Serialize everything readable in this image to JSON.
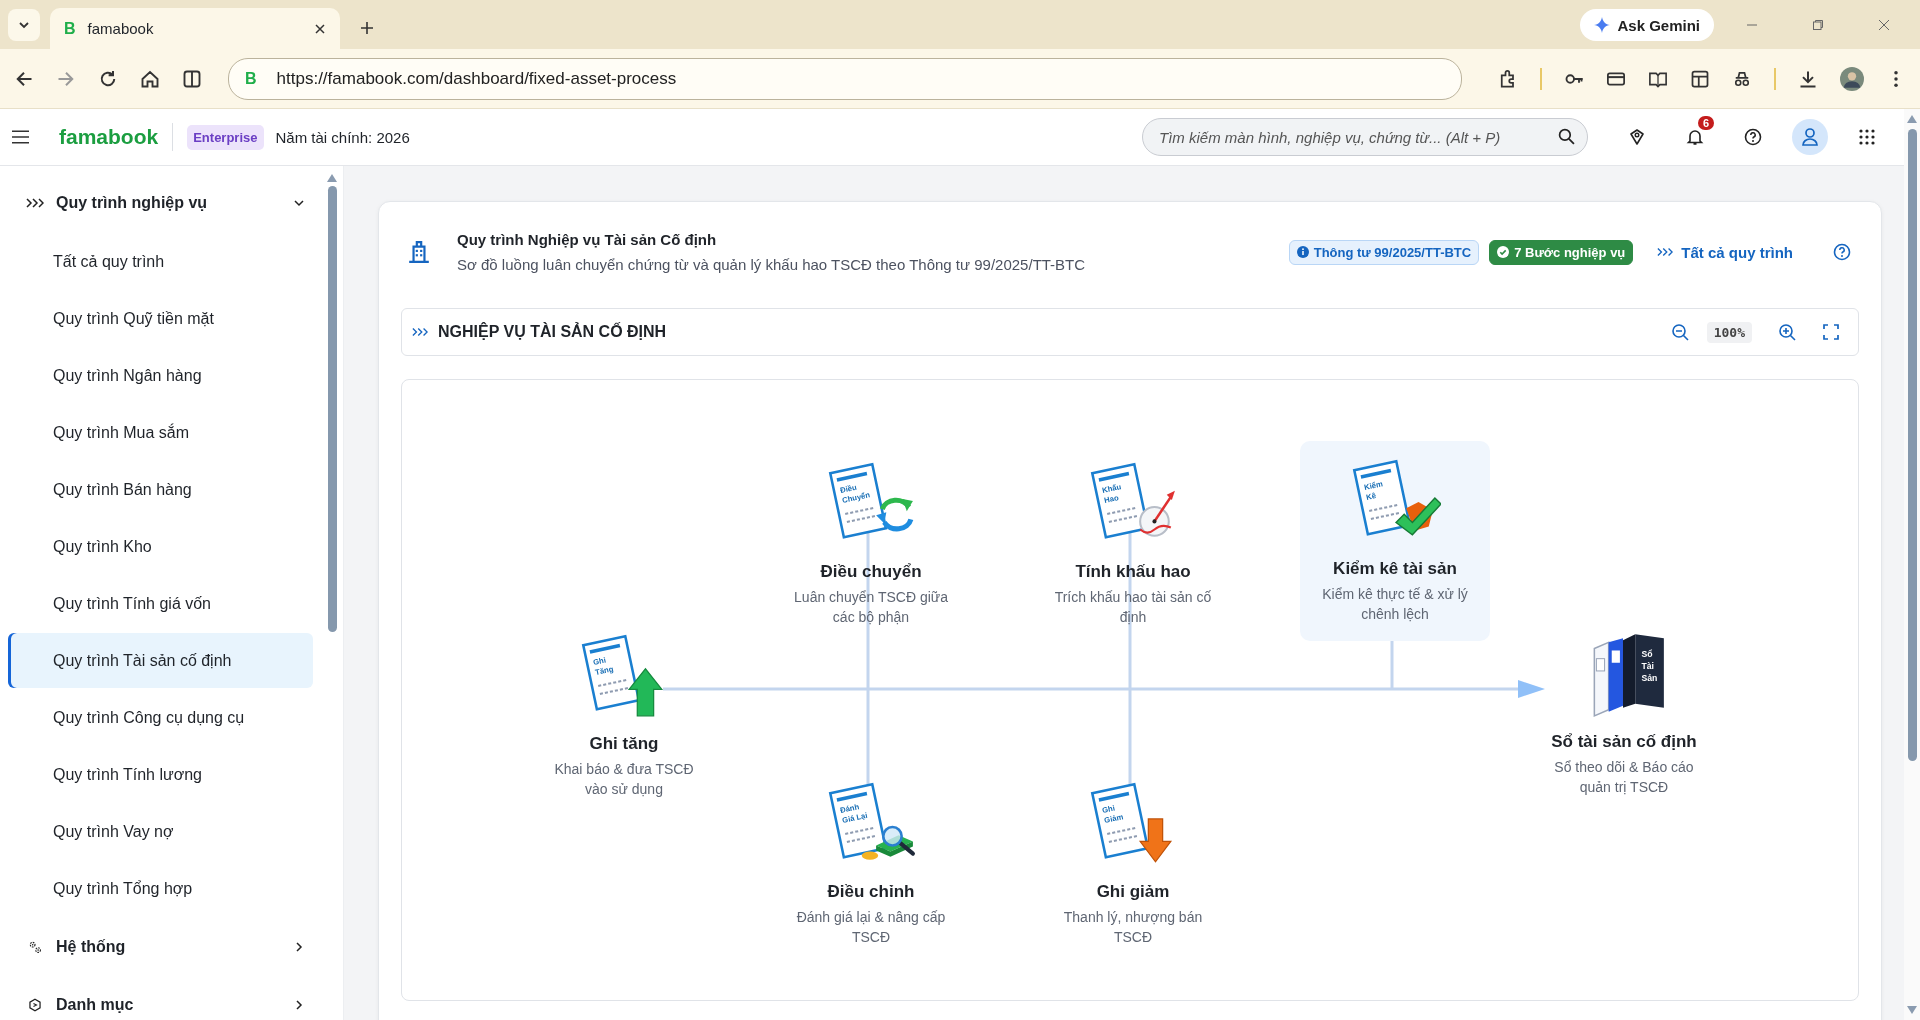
{
  "browser": {
    "tab_title": "famabook",
    "favicon": "B",
    "url": "https://famabook.com/dashboard/fixed-asset-process",
    "site_badge": "B",
    "gemini_label": "Ask Gemini"
  },
  "app_header": {
    "logo": "famabook",
    "plan": "Enterprise",
    "fiscal_year": "Năm tài chính: 2026",
    "search": {
      "placeholder": "Tìm kiếm màn hình, nghiệp vụ, chứng từ... (Alt + P)"
    },
    "notification_count": "6"
  },
  "sidebar": {
    "sections": [
      {
        "label": "Quy trình nghiệp vụ",
        "kind": "process",
        "expanded": true,
        "children": [
          {
            "label": "Tất cả quy trình",
            "selected": false
          },
          {
            "label": "Quy trình Quỹ tiền mặt",
            "selected": false
          },
          {
            "label": "Quy trình Ngân hàng",
            "selected": false
          },
          {
            "label": "Quy trình Mua sắm",
            "selected": false
          },
          {
            "label": "Quy trình Bán hàng",
            "selected": false
          },
          {
            "label": "Quy trình Kho",
            "selected": false
          },
          {
            "label": "Quy trình Tính giá vốn",
            "selected": false
          },
          {
            "label": "Quy trình Tài sản cố định",
            "selected": true
          },
          {
            "label": "Quy trình Công cụ dụng cụ",
            "selected": false
          },
          {
            "label": "Quy trình Tính lương",
            "selected": false
          },
          {
            "label": "Quy trình Vay nợ",
            "selected": false
          },
          {
            "label": "Quy trình Tổng hợp",
            "selected": false
          }
        ]
      },
      {
        "label": "Hệ thống",
        "kind": "system",
        "expanded": false
      },
      {
        "label": "Danh mục",
        "kind": "catalog",
        "expanded": false
      }
    ]
  },
  "process_card": {
    "title": "Quy trình Nghiệp vụ Tài sản Cố định",
    "subtitle": "Sơ đồ luồng luân chuyển chứng từ và quản lý khấu hao TSCĐ theo Thông tư 99/2025/TT-BTC",
    "badges": [
      {
        "label": "Thông tư 99/2025/TT-BTC",
        "kind": "info"
      },
      {
        "label": "7 Bước nghiệp vụ",
        "kind": "success"
      }
    ],
    "all_link": "Tất cả quy trình"
  },
  "diagram": {
    "title": "NGHIỆP VỤ TÀI SẢN CỐ ĐỊNH",
    "zoom": "100%",
    "nodes": [
      {
        "title": "Ghi tăng",
        "description": "Khai báo & đưa TSCĐ vào sử dụng",
        "kind": "increase",
        "icon_text": [
          "Ghi",
          "Tăng"
        ],
        "highlighted": false
      },
      {
        "title": "Điều chuyển",
        "description": "Luân chuyển TSCĐ giữa các bộ phận",
        "kind": "transfer",
        "icon_text": [
          "Điều",
          "Chuyển"
        ],
        "highlighted": false
      },
      {
        "title": "Tính khấu hao",
        "description": "Trích khấu hao tài sản cố định",
        "kind": "depreciation",
        "icon_text": [
          "Khấu",
          "Hao"
        ],
        "highlighted": false
      },
      {
        "title": "Kiểm kê tài sản",
        "description": "Kiểm kê thực tế & xử lý chênh lệch",
        "kind": "inventory",
        "icon_text": [
          "Kiểm",
          "Kê"
        ],
        "highlighted": true
      },
      {
        "title": "Điều chỉnh",
        "description": "Đánh giá lại & nâng cấp TSCĐ",
        "kind": "revaluation",
        "icon_text": [
          "Đánh",
          "Giá Lại"
        ],
        "highlighted": false
      },
      {
        "title": "Ghi giảm",
        "description": "Thanh lý, nhượng bán TSCĐ",
        "kind": "decrease",
        "icon_text": [
          "Ghi",
          "Giảm"
        ],
        "highlighted": false
      },
      {
        "title": "Sổ tài sản cố định",
        "description": "Sổ theo dõi & Báo cáo quản trị TSCĐ",
        "kind": "ledger",
        "icon_text": [
          "Sổ",
          "Tài",
          "Sản"
        ],
        "highlighted": false
      }
    ]
  }
}
